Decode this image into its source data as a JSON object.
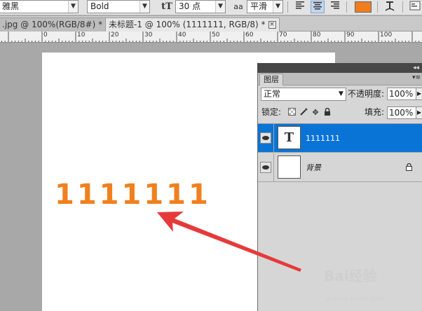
{
  "options_bar": {
    "font_family": "雅黑",
    "font_style": "Bold",
    "font_size_icon": "tT",
    "font_size": "30 点",
    "aa_icon": "aa",
    "antialias": "平滑",
    "color_swatch": "#f07d1e"
  },
  "tabs": [
    {
      "label": ".jpg @ 100%(RGB/8#) *",
      "close": "×"
    },
    {
      "label": "未标题-1 @ 100% (1111111, RGB/8) *",
      "close": "×"
    }
  ],
  "ruler": {
    "numbers": [
      "0",
      "10",
      "20",
      "30",
      "40",
      "50",
      "60",
      "70",
      "80",
      "90",
      "100"
    ]
  },
  "canvas": {
    "text": "1111111",
    "text_color": "#f0801e"
  },
  "layers_panel": {
    "title": "图层",
    "collapse_glyph": "◂◂",
    "blend_mode": "正常",
    "opacity_label": "不透明度:",
    "opacity_value": "100%",
    "lock_label": "锁定:",
    "fill_label": "填充:",
    "fill_value": "100%",
    "layers": [
      {
        "name": "1111111",
        "thumb": "T",
        "selected": true
      },
      {
        "name": "背景",
        "thumb": "",
        "selected": false,
        "locked": true
      }
    ]
  },
  "watermark": {
    "logo": "Bai经验",
    "url": "jingyan.baidu.com"
  }
}
